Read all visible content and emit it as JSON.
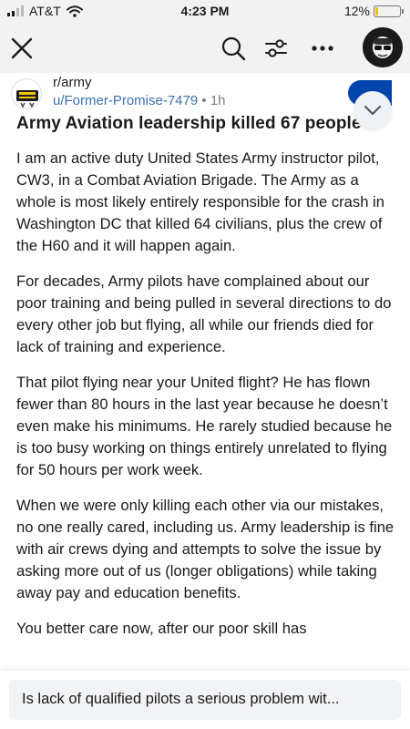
{
  "status_bar": {
    "carrier": "AT&T",
    "time": "4:23 PM",
    "battery_text": "12%",
    "battery_level": 0.12,
    "battery_color": "#f4c20d"
  },
  "nav": {
    "close_icon": "close-icon",
    "search_icon": "search-icon",
    "filter_icon": "sliders-icon",
    "more_icon": "more-icon"
  },
  "post": {
    "subreddit": "r/army",
    "author": "u/Former-Promise-7479",
    "separator": " • ",
    "age": "1h",
    "title": "Army Aviation leadership killed 67 people",
    "paragraphs": [
      "I am an active duty United States Army instructor pilot, CW3, in a Combat Aviation Brigade. The Army as a whole is most likely entirely responsible for the crash in Washington DC that killed 64 civilians, plus the crew of the H60 and it will happen again.",
      "For decades, Army pilots have complained about our poor training and being pulled in several directions to do every other job but flying, all while our friends died for lack of training and experience.",
      "That pilot flying near your United flight? He has flown fewer than 80 hours in the last year because he doesn’t even make his minimums. He rarely studied because he is too busy working on things entirely unrelated to flying for 50 hours per work week.",
      "When we were only killing each other via our mistakes, no one really cared, including us. Army leadership is fine with air crews dying and attempts to solve the issue by asking more out of us (longer obligations) while taking away pay and education benefits.",
      "You better care now, after our poor skill has"
    ]
  },
  "bottom": {
    "suggestion": "Is lack of qualified pilots a serious problem wit..."
  },
  "colors": {
    "link": "#3b6fb6",
    "join_button": "#0045ac",
    "bar_background": "#f2f2f2"
  }
}
